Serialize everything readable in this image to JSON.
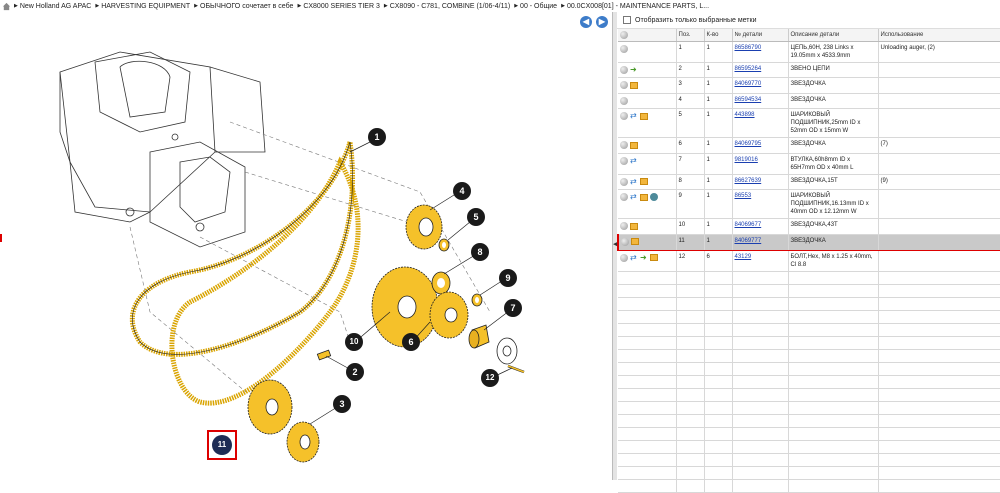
{
  "breadcrumb": [
    "New Holland AG APAC",
    "HARVESTING EQUIPMENT",
    "ОБЫЧНОГО сочетает в себе",
    "CX8000 SERIES TIER 3",
    "CX8090 - C781, COMBINE (1/06-4/11)",
    "00 - Общие",
    "00.0CX008[01] - MAINTENANCE PARTS, L..."
  ],
  "nav": {
    "back": "◀",
    "forward": "▶"
  },
  "filter": {
    "label": "Отобразить только выбранные метки"
  },
  "table": {
    "headers": [
      "",
      "Поз.",
      "К-во",
      "№ детали",
      "Описание детали",
      "Использование"
    ],
    "rows": [
      {
        "icons": [
          "dot"
        ],
        "pos": "1",
        "qty": "1",
        "part": "86586790",
        "desc": "ЦЕПЬ,60H, 238 Links x 19.05mm x 4533.9mm",
        "usage": "Unloading auger, (2)"
      },
      {
        "icons": [
          "dot",
          "green"
        ],
        "pos": "2",
        "qty": "1",
        "part": "86595264",
        "desc": "ЗВЕНО ЦЕПИ",
        "usage": ""
      },
      {
        "icons": [
          "dot",
          "box"
        ],
        "pos": "3",
        "qty": "1",
        "part": "84069770",
        "desc": "ЗВЕЗДОЧКА",
        "usage": ""
      },
      {
        "icons": [
          "dot"
        ],
        "pos": "4",
        "qty": "1",
        "part": "86594534",
        "desc": "ЗВЕЗДОЧКА",
        "usage": ""
      },
      {
        "icons": [
          "dot",
          "swap",
          "box"
        ],
        "pos": "5",
        "qty": "1",
        "part": "443898",
        "desc": "ШАРИКОВЫЙ ПОДШИПНИК,25mm ID x 52mm OD x 15mm W",
        "usage": ""
      },
      {
        "icons": [
          "dot",
          "box"
        ],
        "pos": "6",
        "qty": "1",
        "part": "84069795",
        "desc": "ЗВЕЗДОЧКА",
        "usage": "(7)"
      },
      {
        "icons": [
          "dot",
          "swap"
        ],
        "pos": "7",
        "qty": "1",
        "part": "9819016",
        "desc": "ВТУЛКА,60h8mm ID x 65H7mm OD x 40mm L",
        "usage": ""
      },
      {
        "icons": [
          "dot",
          "swap",
          "box"
        ],
        "pos": "8",
        "qty": "1",
        "part": "86627639",
        "desc": "ЗВЕЗДОЧКА,15T",
        "usage": "(9)"
      },
      {
        "icons": [
          "dot",
          "swap",
          "box",
          "gear"
        ],
        "pos": "9",
        "qty": "1",
        "part": "86553",
        "desc": "ШАРИКОВЫЙ ПОДШИПНИК,16.13mm ID x 40mm OD x 12.12mm W",
        "usage": ""
      },
      {
        "icons": [
          "dot",
          "box"
        ],
        "pos": "10",
        "qty": "1",
        "part": "84069677",
        "desc": "ЗВЕЗДОЧКА,43T",
        "usage": ""
      },
      {
        "icons": [
          "dot",
          "box"
        ],
        "pos": "11",
        "qty": "1",
        "part": "84069777",
        "desc": "ЗВЕЗДОЧКА",
        "usage": "",
        "selected": true
      },
      {
        "icons": [
          "dot",
          "swap",
          "green",
          "box"
        ],
        "pos": "12",
        "qty": "6",
        "part": "43129",
        "desc": "БОЛТ,Hex, M8 x 1.25 x 40mm, Cl 8.8",
        "usage": ""
      }
    ]
  },
  "diagram": {
    "callouts": [
      "1",
      "2",
      "3",
      "4",
      "5",
      "6",
      "7",
      "8",
      "9",
      "10",
      "11",
      "12"
    ]
  },
  "colors": {
    "sprocket": "#f5c12a",
    "callout": "#1a1a1a",
    "highlight": "#dd0000"
  }
}
